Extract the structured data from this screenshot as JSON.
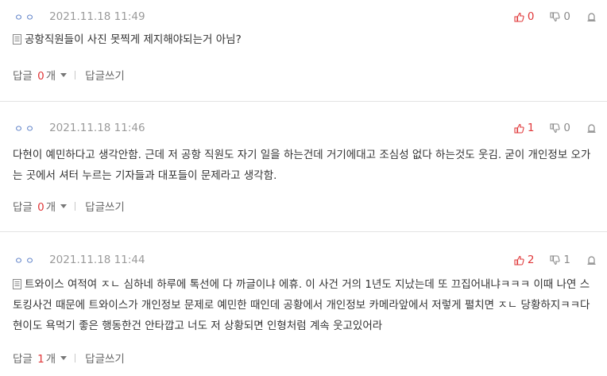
{
  "comments": [
    {
      "nickname": "ㅇㅇ",
      "date": "2021.11.18 11:49",
      "likes": "0",
      "dislikes": "0",
      "text": "공항직원들이 사진 못찍게 제지해야되는거 아님?",
      "reply_label": "답글",
      "reply_count": "0",
      "reply_unit": "개",
      "write_reply": "답글쓰기"
    },
    {
      "nickname": "ㅇㅇ",
      "date": "2021.11.18 11:46",
      "likes": "1",
      "dislikes": "0",
      "text": "다현이 예민하다고 생각안함. 근데 저 공항 직원도 자기 일을 하는건데 거기에대고 조심성 없다 하는것도 웃김. 굳이 개인정보 오가는 곳에서 셔터 누르는 기자들과 대포들이 문제라고 생각함.",
      "reply_label": "답글",
      "reply_count": "0",
      "reply_unit": "개",
      "write_reply": "답글쓰기"
    },
    {
      "nickname": "ㅇㅇ",
      "date": "2021.11.18 11:44",
      "likes": "2",
      "dislikes": "1",
      "text": "트와이스 여적여 ㅈㄴ 심하네 하루에 톡선에 다 까글이냐 에휴. 이 사건 거의 1년도 지났는데 또 끄집어내냐ㅋㅋㅋ 이때 나연 스토킹사건 때문에 트와이스가 개인정보 문제로 예민한 때인데 공황에서 개인정보 카메라앞에서 저렇게 펼치면 ㅈㄴ 당황하지ㅋㅋ다현이도 욕먹기 좋은 행동한건 안타깝고 너도 저 상황되면 인형처럼 계속 웃고있어라",
      "reply_label": "답글",
      "reply_count": "1",
      "reply_unit": "개",
      "write_reply": "답글쓰기"
    }
  ],
  "icons": {
    "like": "thumbs-up-icon",
    "dislike": "thumbs-down-icon",
    "report": "report-icon",
    "document": "document-icon",
    "caret": "caret-down-icon"
  },
  "colors": {
    "accent_red": "#e0383a",
    "nickname_blue": "#5b7fc7",
    "muted": "#9a9a9a"
  }
}
